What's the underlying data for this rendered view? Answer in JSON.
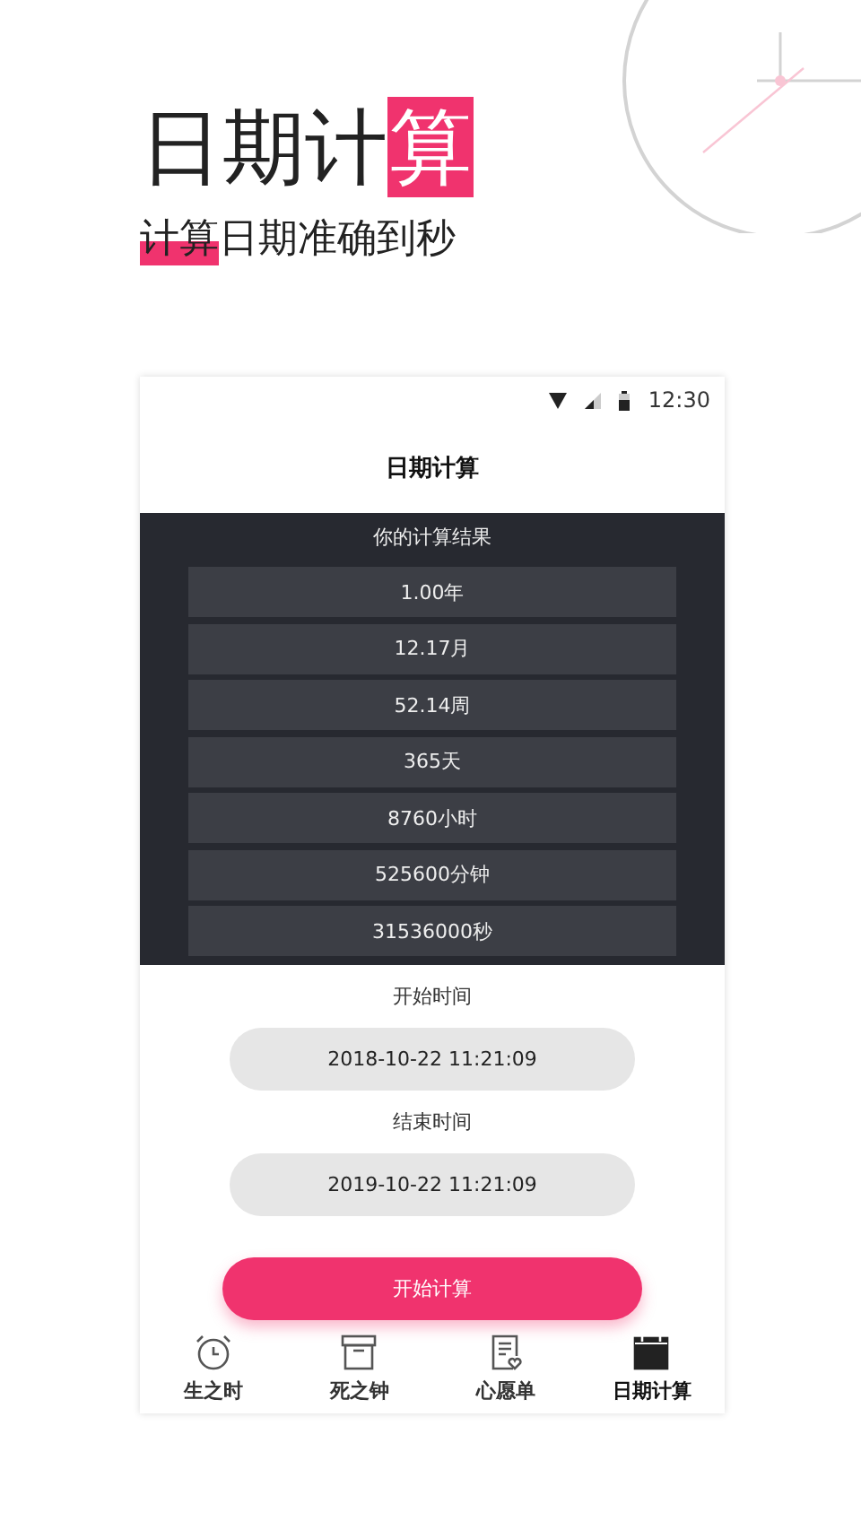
{
  "headline": [
    {
      "text": "日期计",
      "highlight": false
    },
    {
      "text": "算",
      "highlight": true
    }
  ],
  "tagline": [
    {
      "text": "计算",
      "highlight": true
    },
    {
      "text": "日期准确到秒",
      "highlight": false
    }
  ],
  "status_bar": {
    "time": "12:30"
  },
  "app_bar": {
    "title": "日期计算"
  },
  "results": {
    "title": "你的计算结果",
    "rows": [
      "1.00年",
      "12.17月",
      "52.14周",
      "365天",
      "8760小时",
      "525600分钟",
      "31536000秒"
    ]
  },
  "start": {
    "label": "开始时间",
    "value": "2018-10-22 11:21:09"
  },
  "end": {
    "label": "结束时间",
    "value": "2019-10-22 11:21:09"
  },
  "button": "开始计算",
  "nav": [
    {
      "label": "生之时",
      "selected": false
    },
    {
      "label": "死之钟",
      "selected": false
    },
    {
      "label": "心愿单",
      "selected": false
    },
    {
      "label": "日期计算",
      "selected": true
    }
  ]
}
